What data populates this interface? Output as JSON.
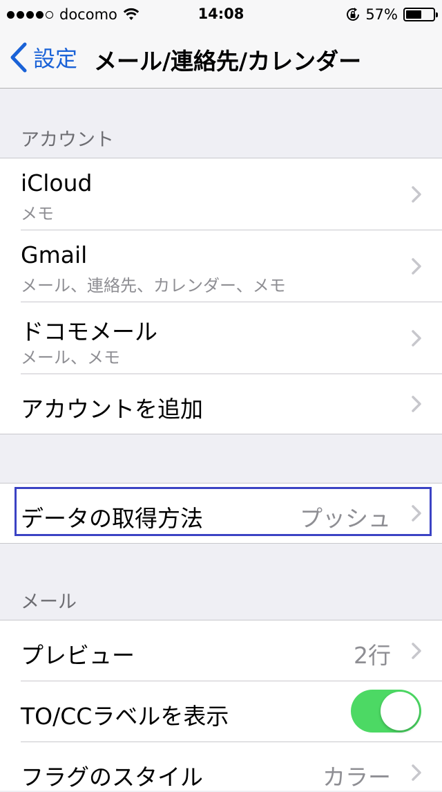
{
  "status_bar": {
    "carrier": "docomo",
    "signal_bars_filled": 4,
    "signal_bars_total": 5,
    "time": "14:08",
    "battery_percent_label": "57%",
    "battery_level": 0.57
  },
  "nav": {
    "back_label": "設定",
    "title": "メール/連絡先/カレンダー",
    "accent_color": "#1a62d7"
  },
  "accounts_section": {
    "header": "アカウント",
    "items": [
      {
        "title": "iCloud",
        "subtitle": "メモ"
      },
      {
        "title": "Gmail",
        "subtitle": "メール、連絡先、カレンダー、メモ"
      },
      {
        "title": "ドコモメール",
        "subtitle": "メール、メモ"
      },
      {
        "title": "アカウントを追加"
      }
    ]
  },
  "fetch_section": {
    "title": "データの取得方法",
    "value": "プッシュ",
    "highlight_color": "#3b43c4"
  },
  "mail_section": {
    "header": "メール",
    "preview": {
      "title": "プレビュー",
      "value": "2行"
    },
    "to_cc": {
      "title": "TO/CCラベルを表示",
      "toggle_on": true,
      "toggle_color": "#4cd964"
    },
    "flag_style": {
      "title": "フラグのスタイル",
      "value": "カラー"
    }
  }
}
